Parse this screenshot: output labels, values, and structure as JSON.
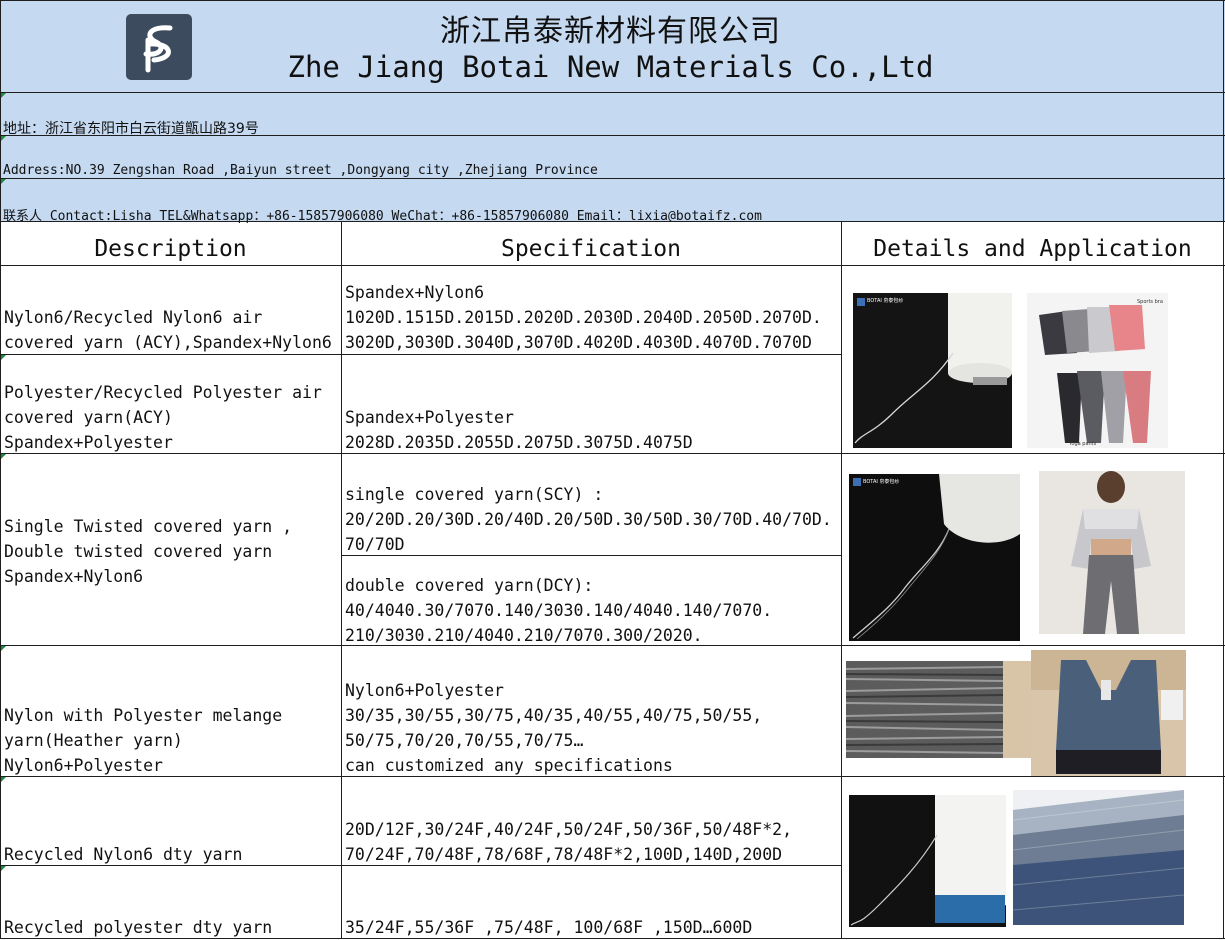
{
  "header": {
    "company_cn": "浙江帛泰新材料有限公司",
    "company_en": "Zhe Jiang Botai New Materials Co.,Ltd",
    "address_cn": "地址：浙江省东阳市白云街道甑山路39号",
    "address_en": "Address:NO.39 Zengshan Road ,Baiyun street ,Dongyang city ,Zhejiang Province",
    "contact": "联系人 Contact:Lisha   TEL&Whatsapp：+86-15857906080    WeChat：+86-15857906080    Email：lixia@botaifz.com"
  },
  "table": {
    "headers": [
      "Description",
      "Specification",
      "Details and Application"
    ],
    "rows": [
      {
        "description": [
          "Nylon6/Recycled Nylon6 air",
          "covered yarn (ACY),Spandex+Nylon6"
        ],
        "specification": [
          "Spandex+Nylon6",
          "1020D.1515D.2015D.2020D.2030D.2040D.2050D.2070D.",
          "3020D,3030D.3040D,3070D.4020D.4030D.4070D.7070D"
        ]
      },
      {
        "description": [
          "Polyester/Recycled Polyester air",
          "covered yarn(ACY)",
          "Spandex+Polyester"
        ],
        "specification": [
          "Spandex+Polyester",
          "2028D.2035D.2055D.2075D.3075D.4075D"
        ]
      },
      {
        "description": [
          "Single Twisted covered yarn ,",
          "Double twisted covered yarn",
          "Spandex+Nylon6"
        ],
        "specification_a": [
          "single covered yarn(SCY) :",
          "20/20D.20/30D.20/40D.20/50D.30/50D.30/70D.40/70D.",
          "70/70D"
        ],
        "specification_b": [
          "double covered yarn(DCY):",
          "40/4040.30/7070.140/3030.140/4040.140/7070.",
          "210/3030.210/4040.210/7070.300/2020."
        ]
      },
      {
        "description": [
          "Nylon with Polyester melange",
          "yarn(Heather yarn)",
          "Nylon6+Polyester"
        ],
        "specification": [
          "Nylon6+Polyester",
          "30/35,30/55,30/75,40/35,40/55,40/75,50/55,",
          "50/75,70/20,70/55,70/75…",
          "can customized any specifications"
        ]
      },
      {
        "description": [
          "Recycled Nylon6 dty yarn"
        ],
        "specification": [
          "20D/12F,30/24F,40/24F,50/24F,50/36F,50/48F*2,",
          "70/24F,70/48F,78/68F,78/48F*2,100D,140D,200D"
        ]
      },
      {
        "description": [
          "Recycled polyester dty yarn"
        ],
        "specification": [
          "35/24F,55/36F ,75/48F, 100/68F ,150D…600D"
        ]
      }
    ]
  },
  "images": {
    "yarn_cone_1_label": "BOTAI 帛泰包纱",
    "sportswear_1_labels": [
      "Sports bra",
      "Yoga pants"
    ],
    "yarn_cone_2_label": "BOTAI 帛泰包纱"
  },
  "colors": {
    "header_bg": "#c5d9f1",
    "grid": "#1e1e1e",
    "logo_bg": "#3c4b5d",
    "marker": "#1c8a3a"
  }
}
